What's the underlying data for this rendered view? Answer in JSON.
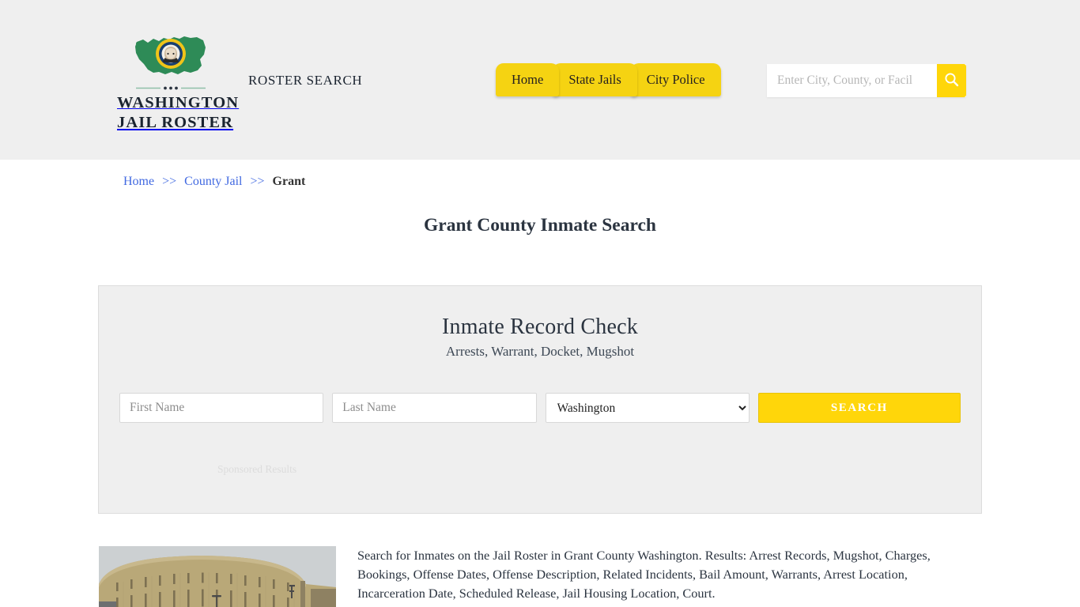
{
  "header": {
    "logo": {
      "icon": "washington-state-seal-icon",
      "line1": "WASHINGTON",
      "line2": "JAIL ROSTER",
      "divider_icon": "ornament-divider-icon"
    },
    "tagline": "ROSTER SEARCH",
    "nav": [
      {
        "label": "Home"
      },
      {
        "label": "State Jails"
      },
      {
        "label": "City Police"
      }
    ],
    "search": {
      "placeholder": "Enter City, County, or Facil",
      "value": "",
      "button_icon": "search-icon"
    },
    "background_color": "#efefef",
    "accent_color": "#f5d312"
  },
  "breadcrumb": {
    "items": [
      {
        "label": "Home",
        "current": false
      },
      {
        "label": "County Jail",
        "current": false
      },
      {
        "label": "Grant",
        "current": true
      }
    ],
    "separator": ">>",
    "link_color": "#4169e1"
  },
  "page": {
    "title": "Grant County Inmate Search"
  },
  "record_check": {
    "heading": "Inmate Record Check",
    "subheading": "Arrests, Warrant, Docket, Mugshot",
    "form": {
      "first_name_placeholder": "First Name",
      "first_name_value": "",
      "last_name_placeholder": "Last Name",
      "last_name_value": "",
      "state_selected": "Washington",
      "state_options": [
        "Washington"
      ],
      "submit_label": "SEARCH",
      "submit_color": "#ffd60a"
    },
    "sponsored_label": "Sponsored Results"
  },
  "content": {
    "photo_alt": "grant-county-jail-building-photo",
    "description": "Search for Inmates on the Jail Roster in Grant County Washington. Results: Arrest Records, Mugshot, Charges, Bookings, Offense Dates, Offense Description, Related Incidents, Bail Amount, Warrants, Arrest Location, Incarceration Date, Scheduled Release, Jail Housing Location, Court."
  }
}
